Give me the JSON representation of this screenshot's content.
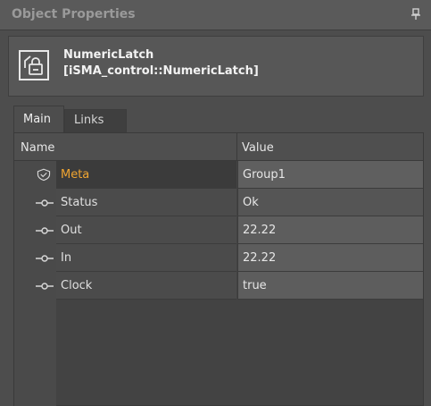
{
  "panel": {
    "title": "Object Properties",
    "pin_icon": "pin-icon"
  },
  "object": {
    "name": "NumericLatch",
    "type": "[iSMA_control::NumericLatch]",
    "icon": "latch-icon"
  },
  "tabs": [
    {
      "label": "Main",
      "active": true
    },
    {
      "label": "Links",
      "active": false
    }
  ],
  "grid": {
    "columns": {
      "name": "Name",
      "value": "Value"
    },
    "rows": [
      {
        "name": "Meta",
        "value": "Group1",
        "icon": "shield-icon",
        "highlight": "#f0a531"
      },
      {
        "name": "Status",
        "value": "Ok",
        "icon": "slot-icon"
      },
      {
        "name": "Out",
        "value": "22.22",
        "icon": "slot-icon"
      },
      {
        "name": "In",
        "value": "22.22",
        "icon": "slot-icon"
      },
      {
        "name": "Clock",
        "value": "true",
        "icon": "slot-icon"
      }
    ]
  }
}
